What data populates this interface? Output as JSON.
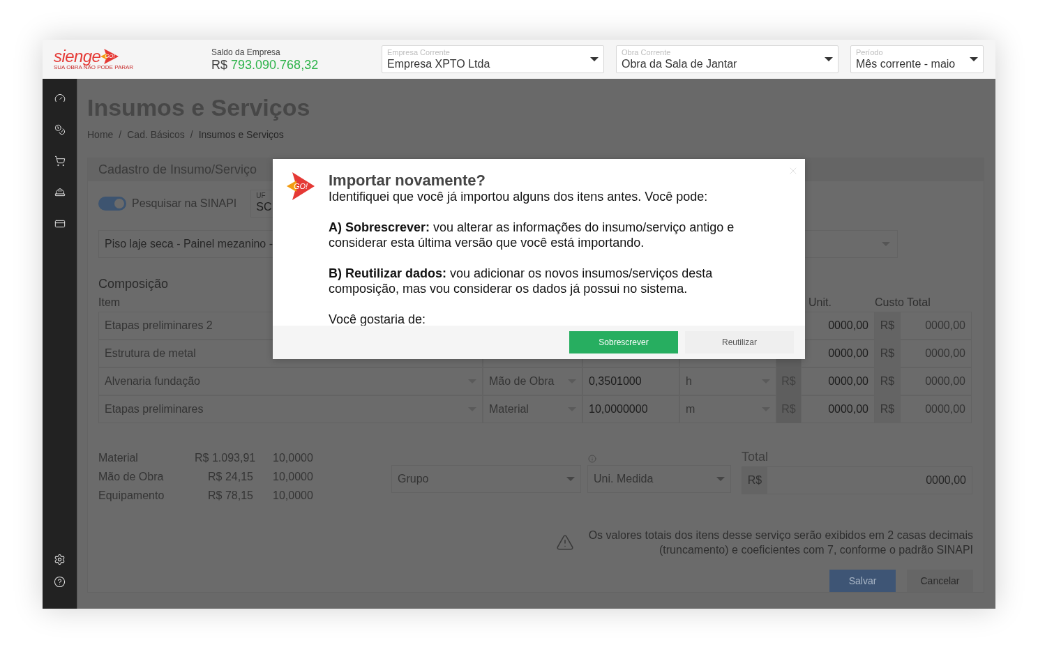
{
  "header": {
    "logo": {
      "wordmark": "sienge",
      "badge": "GO!",
      "tagline": "SUA OBRA NÃO PODE PARAR"
    },
    "balance": {
      "label": "Saldo da Empresa",
      "currency": "R$",
      "amount": "793.090.768,32"
    },
    "selectors": [
      {
        "label": "Empresa Corrente",
        "value": "Empresa XPTO Ltda"
      },
      {
        "label": "Obra Corrente",
        "value": "Obra da Sala de Jantar"
      },
      {
        "label": "Período",
        "value": "Mês corrente - maio"
      }
    ]
  },
  "page": {
    "title": "Insumos e Serviços",
    "breadcrumb": [
      {
        "kind": "link",
        "label": "Home"
      },
      {
        "kind": "separator",
        "label": "/"
      },
      {
        "kind": "link",
        "label": "Cad. Básicos"
      },
      {
        "kind": "separator",
        "label": "/"
      },
      {
        "kind": "current",
        "label": "Insumos e Serviços"
      }
    ]
  },
  "form": {
    "title": "Cadastro de Insumo/Serviço",
    "sinapi_toggle": {
      "label": "Pesquisar na SINAPI",
      "on": true
    },
    "uf": {
      "label": "UF",
      "value": "SC"
    },
    "search": {
      "value": "Piso laje seca - Painel mezanino -"
    },
    "composition": {
      "title": "Composição",
      "headers": [
        "Item",
        "Unit.",
        "Custo Total"
      ],
      "rows": [
        {
          "item": "Etapas preliminares 2",
          "unit_price": "0000,00",
          "total_currency": "R$",
          "total": "0000,00"
        },
        {
          "item": "Estrutura de metal",
          "unit_price": "0000,00",
          "total_currency": "R$",
          "total": "0000,00"
        },
        {
          "item": "Alvenaria fundação",
          "type": "Mão de Obra",
          "coefficient": "0,3501000",
          "unit": "h",
          "price_currency": "R$",
          "unit_price": "0000,00",
          "total_currency": "R$",
          "total": "0000,00"
        },
        {
          "item": "Etapas preliminares",
          "type": "Material",
          "coefficient": "10,0000000",
          "unit": "m",
          "price_currency": "R$",
          "unit_price": "0000,00",
          "total_currency": "R$",
          "total": "0000,00"
        }
      ]
    },
    "summary": [
      {
        "label": "Material",
        "value": "R$ 1.093,91",
        "quantity": "10,0000"
      },
      {
        "label": "Mão de Obra",
        "value": "R$ 24,15",
        "quantity": "10,0000"
      },
      {
        "label": "Equipamento",
        "value": "R$ 78,15",
        "quantity": "10,0000"
      }
    ],
    "group_select": {
      "placeholder": "Grupo"
    },
    "unit_select": {
      "placeholder": "Uni. Medida"
    },
    "total": {
      "label": "Total",
      "currency": "R$",
      "value": "0000,00"
    },
    "notice": "Os valores totais dos itens desse serviço serão exibidos em 2 casas decimais (truncamento) e coeficientes com 7, conforme o padrão SINAPI",
    "buttons": [
      {
        "label": "Salvar",
        "kind": "primary"
      },
      {
        "label": "Cancelar",
        "kind": "secondary"
      }
    ]
  },
  "modal": {
    "badge": "GO!",
    "title": "Importar novamente?",
    "paragraphs": [
      "Identifiquei que você já importou alguns dos itens antes. Você pode:",
      "**A) Sobrescrever:** vou alterar as informações do insumo/serviço antigo e considerar esta última versão que você está importando.",
      "**B) Reutilizar dados:** vou adicionar os novos insumos/serviços desta composição, mas vou considerar os dados já possui no sistema.",
      "Você gostaria de:"
    ],
    "buttons": [
      {
        "label": "Sobrescrever",
        "kind": "primary"
      },
      {
        "label": "Reutilizar",
        "kind": "secondary"
      }
    ]
  }
}
